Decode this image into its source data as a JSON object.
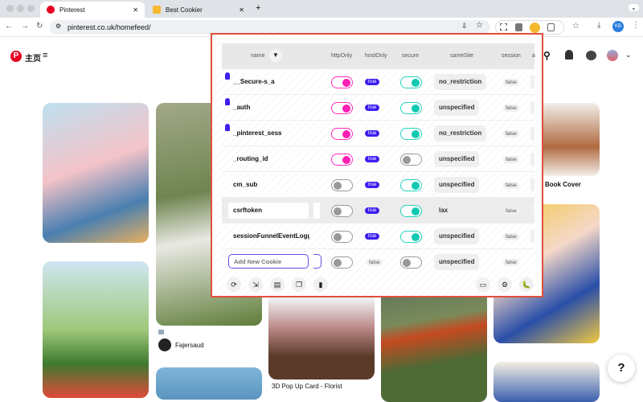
{
  "browser": {
    "tabs": [
      {
        "title": "Pinterest",
        "active": true
      },
      {
        "title": "Best Cookier",
        "active": false
      }
    ],
    "new_tab": "+",
    "url": "pinterest.co.uk/homefeed/",
    "profile_initials": "KB"
  },
  "pinterest": {
    "home_label": "主页",
    "menu_icon": "≡",
    "captions": {
      "fajersaud": "Fajersaud",
      "florist": "3D Pop Up Card - Florist",
      "book_cover": "Book Cover"
    },
    "help": "?"
  },
  "cookie_editor": {
    "columns": {
      "name": "name",
      "httpOnly": "httpOnly",
      "hostOnly": "hostOnly",
      "secure": "secure",
      "sameSite": "sameSite",
      "session": "session",
      "extra": "a"
    },
    "cookies": [
      {
        "name": "__Secure-s_a",
        "httpOnly": true,
        "hostOnly": "true",
        "secure": true,
        "sameSite": "no_restriction",
        "session": "false",
        "pinned": true
      },
      {
        "name": "_auth",
        "httpOnly": true,
        "hostOnly": "true",
        "secure": true,
        "sameSite": "unspecified",
        "session": "false",
        "pinned": true
      },
      {
        "name": "_pinterest_sess",
        "httpOnly": true,
        "hostOnly": "true",
        "secure": true,
        "sameSite": "no_restriction",
        "session": "false",
        "pinned": true
      },
      {
        "name": "_routing_id",
        "httpOnly": true,
        "hostOnly": "true",
        "secure": false,
        "sameSite": "unspecified",
        "session": "false",
        "pinned": false
      },
      {
        "name": "cm_sub",
        "httpOnly": false,
        "hostOnly": "true",
        "secure": true,
        "sameSite": "unspecified",
        "session": "false",
        "pinned": false
      },
      {
        "name": "csrftoken",
        "httpOnly": false,
        "hostOnly": "true",
        "secure": true,
        "sameSite": "lax",
        "session": "false",
        "pinned": false,
        "editing": true
      },
      {
        "name": "sessionFunnelEventLogged",
        "httpOnly": false,
        "hostOnly": "true",
        "secure": true,
        "sameSite": "unspecified",
        "session": "false",
        "pinned": false
      }
    ],
    "new_row": {
      "placeholder": "Add New Cookie",
      "hostOnly": "false",
      "sameSite": "unspecified",
      "session": "false"
    },
    "colors": {
      "border": "#e0503c",
      "httpOnly": "#ff1fb5",
      "secure": "#12c9b2",
      "badge": "#3d1ff0"
    }
  }
}
